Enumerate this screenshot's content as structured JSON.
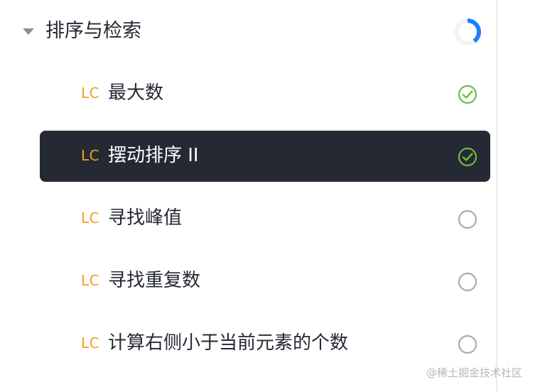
{
  "section": {
    "title": "排序与检索",
    "collapse_icon": "caret-down-icon",
    "progress_fraction": 0.4,
    "progress_color": "#1e80ff",
    "progress_track_color": "#f2f3f5"
  },
  "problems": [
    {
      "tag": "LC",
      "name": "最大数",
      "status": "completed",
      "status_icon": "check-circle-icon"
    },
    {
      "tag": "LC",
      "name": "摆动排序 II",
      "status": "completed",
      "status_icon": "check-circle-icon",
      "active": true
    },
    {
      "tag": "LC",
      "name": "寻找峰值",
      "status": "not-started",
      "status_icon": "empty-circle-icon"
    },
    {
      "tag": "LC",
      "name": "寻找重复数",
      "status": "not-started",
      "status_icon": "empty-circle-icon"
    },
    {
      "tag": "LC",
      "name": "计算右侧小于当前元素的个数",
      "status": "not-started",
      "status_icon": "empty-circle-icon"
    }
  ],
  "colors": {
    "tag": "#f0a020",
    "check": "#6cbd45",
    "empty": "#a9abb0",
    "active_bg": "#252933"
  },
  "watermark": "@稀土掘金技术社区"
}
